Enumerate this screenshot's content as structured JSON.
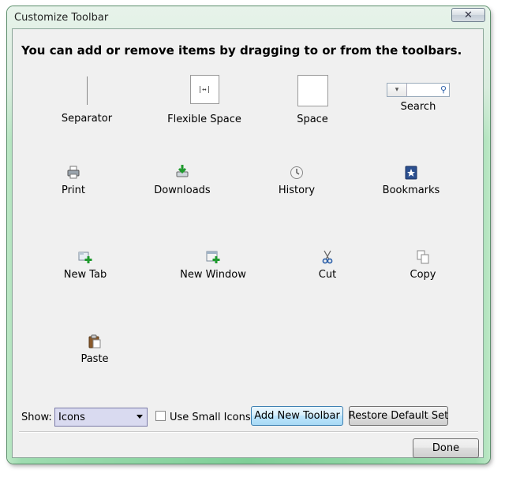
{
  "window": {
    "title": "Customize Toolbar",
    "close_glyph": "✕"
  },
  "heading": "You can add or remove items by dragging to or from the toolbars.",
  "items": [
    {
      "label": "Separator",
      "icon": "separator-icon"
    },
    {
      "label": "Flexible Space",
      "icon": "flexible-space-icon",
      "glyph": "|↔|"
    },
    {
      "label": "Space",
      "icon": "space-icon"
    },
    {
      "label": "Search",
      "icon": "search-box-icon"
    },
    {
      "label": "Print",
      "icon": "printer-icon"
    },
    {
      "label": "Downloads",
      "icon": "download-icon"
    },
    {
      "label": "History",
      "icon": "clock-icon"
    },
    {
      "label": "Bookmarks",
      "icon": "bookmark-star-icon"
    },
    {
      "label": "New Tab",
      "icon": "new-tab-icon"
    },
    {
      "label": "New Window",
      "icon": "new-window-icon"
    },
    {
      "label": "Cut",
      "icon": "scissors-icon"
    },
    {
      "label": "Copy",
      "icon": "copy-icon"
    },
    {
      "label": "Paste",
      "icon": "clipboard-icon"
    }
  ],
  "controls": {
    "show_label": "Show:",
    "show_selected": "Icons",
    "small_icons_label": "Use Small Icons",
    "small_icons_checked": false,
    "add_toolbar_label": "Add New Toolbar",
    "restore_label": "Restore Default Set",
    "done_label": "Done"
  },
  "colors": {
    "frame": "#7fcf98",
    "button_border": "#3c7fb1",
    "dialog_bg": "#f0f0f0"
  }
}
